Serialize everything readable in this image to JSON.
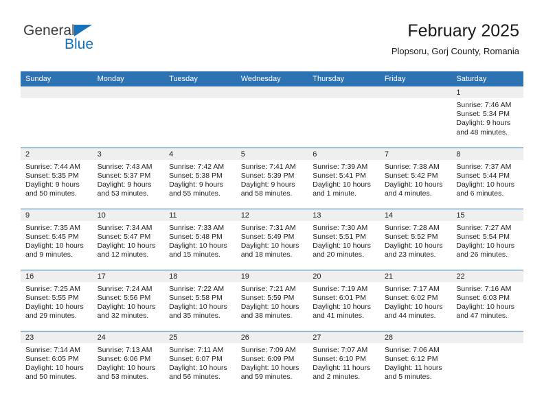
{
  "brand": {
    "name_part1": "General",
    "name_part2": "Blue",
    "accent_color": "#1572bb",
    "triangle_icon": "triangle-icon"
  },
  "header": {
    "title": "February 2025",
    "subtitle": "Plopsoru, Gorj County, Romania"
  },
  "calendar": {
    "header_color": "#2d73b4",
    "daynum_band_color": "#efefef",
    "weekdays": [
      "Sunday",
      "Monday",
      "Tuesday",
      "Wednesday",
      "Thursday",
      "Friday",
      "Saturday"
    ],
    "weeks": [
      [
        {
          "day": "",
          "sunrise": "",
          "sunset": "",
          "daylight_line1": "",
          "daylight_line2": ""
        },
        {
          "day": "",
          "sunrise": "",
          "sunset": "",
          "daylight_line1": "",
          "daylight_line2": ""
        },
        {
          "day": "",
          "sunrise": "",
          "sunset": "",
          "daylight_line1": "",
          "daylight_line2": ""
        },
        {
          "day": "",
          "sunrise": "",
          "sunset": "",
          "daylight_line1": "",
          "daylight_line2": ""
        },
        {
          "day": "",
          "sunrise": "",
          "sunset": "",
          "daylight_line1": "",
          "daylight_line2": ""
        },
        {
          "day": "",
          "sunrise": "",
          "sunset": "",
          "daylight_line1": "",
          "daylight_line2": ""
        },
        {
          "day": "1",
          "sunrise": "Sunrise: 7:46 AM",
          "sunset": "Sunset: 5:34 PM",
          "daylight_line1": "Daylight: 9 hours",
          "daylight_line2": "and 48 minutes."
        }
      ],
      [
        {
          "day": "2",
          "sunrise": "Sunrise: 7:44 AM",
          "sunset": "Sunset: 5:35 PM",
          "daylight_line1": "Daylight: 9 hours",
          "daylight_line2": "and 50 minutes."
        },
        {
          "day": "3",
          "sunrise": "Sunrise: 7:43 AM",
          "sunset": "Sunset: 5:37 PM",
          "daylight_line1": "Daylight: 9 hours",
          "daylight_line2": "and 53 minutes."
        },
        {
          "day": "4",
          "sunrise": "Sunrise: 7:42 AM",
          "sunset": "Sunset: 5:38 PM",
          "daylight_line1": "Daylight: 9 hours",
          "daylight_line2": "and 55 minutes."
        },
        {
          "day": "5",
          "sunrise": "Sunrise: 7:41 AM",
          "sunset": "Sunset: 5:39 PM",
          "daylight_line1": "Daylight: 9 hours",
          "daylight_line2": "and 58 minutes."
        },
        {
          "day": "6",
          "sunrise": "Sunrise: 7:39 AM",
          "sunset": "Sunset: 5:41 PM",
          "daylight_line1": "Daylight: 10 hours",
          "daylight_line2": "and 1 minute."
        },
        {
          "day": "7",
          "sunrise": "Sunrise: 7:38 AM",
          "sunset": "Sunset: 5:42 PM",
          "daylight_line1": "Daylight: 10 hours",
          "daylight_line2": "and 4 minutes."
        },
        {
          "day": "8",
          "sunrise": "Sunrise: 7:37 AM",
          "sunset": "Sunset: 5:44 PM",
          "daylight_line1": "Daylight: 10 hours",
          "daylight_line2": "and 6 minutes."
        }
      ],
      [
        {
          "day": "9",
          "sunrise": "Sunrise: 7:35 AM",
          "sunset": "Sunset: 5:45 PM",
          "daylight_line1": "Daylight: 10 hours",
          "daylight_line2": "and 9 minutes."
        },
        {
          "day": "10",
          "sunrise": "Sunrise: 7:34 AM",
          "sunset": "Sunset: 5:47 PM",
          "daylight_line1": "Daylight: 10 hours",
          "daylight_line2": "and 12 minutes."
        },
        {
          "day": "11",
          "sunrise": "Sunrise: 7:33 AM",
          "sunset": "Sunset: 5:48 PM",
          "daylight_line1": "Daylight: 10 hours",
          "daylight_line2": "and 15 minutes."
        },
        {
          "day": "12",
          "sunrise": "Sunrise: 7:31 AM",
          "sunset": "Sunset: 5:49 PM",
          "daylight_line1": "Daylight: 10 hours",
          "daylight_line2": "and 18 minutes."
        },
        {
          "day": "13",
          "sunrise": "Sunrise: 7:30 AM",
          "sunset": "Sunset: 5:51 PM",
          "daylight_line1": "Daylight: 10 hours",
          "daylight_line2": "and 20 minutes."
        },
        {
          "day": "14",
          "sunrise": "Sunrise: 7:28 AM",
          "sunset": "Sunset: 5:52 PM",
          "daylight_line1": "Daylight: 10 hours",
          "daylight_line2": "and 23 minutes."
        },
        {
          "day": "15",
          "sunrise": "Sunrise: 7:27 AM",
          "sunset": "Sunset: 5:54 PM",
          "daylight_line1": "Daylight: 10 hours",
          "daylight_line2": "and 26 minutes."
        }
      ],
      [
        {
          "day": "16",
          "sunrise": "Sunrise: 7:25 AM",
          "sunset": "Sunset: 5:55 PM",
          "daylight_line1": "Daylight: 10 hours",
          "daylight_line2": "and 29 minutes."
        },
        {
          "day": "17",
          "sunrise": "Sunrise: 7:24 AM",
          "sunset": "Sunset: 5:56 PM",
          "daylight_line1": "Daylight: 10 hours",
          "daylight_line2": "and 32 minutes."
        },
        {
          "day": "18",
          "sunrise": "Sunrise: 7:22 AM",
          "sunset": "Sunset: 5:58 PM",
          "daylight_line1": "Daylight: 10 hours",
          "daylight_line2": "and 35 minutes."
        },
        {
          "day": "19",
          "sunrise": "Sunrise: 7:21 AM",
          "sunset": "Sunset: 5:59 PM",
          "daylight_line1": "Daylight: 10 hours",
          "daylight_line2": "and 38 minutes."
        },
        {
          "day": "20",
          "sunrise": "Sunrise: 7:19 AM",
          "sunset": "Sunset: 6:01 PM",
          "daylight_line1": "Daylight: 10 hours",
          "daylight_line2": "and 41 minutes."
        },
        {
          "day": "21",
          "sunrise": "Sunrise: 7:17 AM",
          "sunset": "Sunset: 6:02 PM",
          "daylight_line1": "Daylight: 10 hours",
          "daylight_line2": "and 44 minutes."
        },
        {
          "day": "22",
          "sunrise": "Sunrise: 7:16 AM",
          "sunset": "Sunset: 6:03 PM",
          "daylight_line1": "Daylight: 10 hours",
          "daylight_line2": "and 47 minutes."
        }
      ],
      [
        {
          "day": "23",
          "sunrise": "Sunrise: 7:14 AM",
          "sunset": "Sunset: 6:05 PM",
          "daylight_line1": "Daylight: 10 hours",
          "daylight_line2": "and 50 minutes."
        },
        {
          "day": "24",
          "sunrise": "Sunrise: 7:13 AM",
          "sunset": "Sunset: 6:06 PM",
          "daylight_line1": "Daylight: 10 hours",
          "daylight_line2": "and 53 minutes."
        },
        {
          "day": "25",
          "sunrise": "Sunrise: 7:11 AM",
          "sunset": "Sunset: 6:07 PM",
          "daylight_line1": "Daylight: 10 hours",
          "daylight_line2": "and 56 minutes."
        },
        {
          "day": "26",
          "sunrise": "Sunrise: 7:09 AM",
          "sunset": "Sunset: 6:09 PM",
          "daylight_line1": "Daylight: 10 hours",
          "daylight_line2": "and 59 minutes."
        },
        {
          "day": "27",
          "sunrise": "Sunrise: 7:07 AM",
          "sunset": "Sunset: 6:10 PM",
          "daylight_line1": "Daylight: 11 hours",
          "daylight_line2": "and 2 minutes."
        },
        {
          "day": "28",
          "sunrise": "Sunrise: 7:06 AM",
          "sunset": "Sunset: 6:12 PM",
          "daylight_line1": "Daylight: 11 hours",
          "daylight_line2": "and 5 minutes."
        },
        {
          "day": "",
          "sunrise": "",
          "sunset": "",
          "daylight_line1": "",
          "daylight_line2": ""
        }
      ]
    ]
  }
}
